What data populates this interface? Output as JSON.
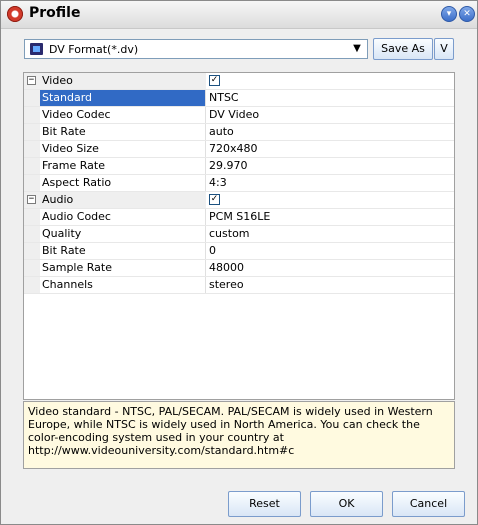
{
  "window": {
    "title": "Profile"
  },
  "format": {
    "value": "DV Format(*.dv)",
    "save_as_label": "Save As",
    "v_label": "V"
  },
  "grid": {
    "video": {
      "label": "Video",
      "checked": "✓",
      "items": [
        {
          "name": "Standard",
          "value": "NTSC"
        },
        {
          "name": "Video Codec",
          "value": "DV Video"
        },
        {
          "name": "Bit Rate",
          "value": "auto"
        },
        {
          "name": "Video Size",
          "value": "720x480"
        },
        {
          "name": "Frame Rate",
          "value": "29.970"
        },
        {
          "name": "Aspect Ratio",
          "value": "4:3"
        }
      ]
    },
    "audio": {
      "label": "Audio",
      "checked": "✓",
      "items": [
        {
          "name": "Audio Codec",
          "value": "PCM S16LE"
        },
        {
          "name": "Quality",
          "value": "custom"
        },
        {
          "name": "Bit Rate",
          "value": "0"
        },
        {
          "name": "Sample Rate",
          "value": "48000"
        },
        {
          "name": "Channels",
          "value": "stereo"
        }
      ]
    },
    "expander_symbol": "−"
  },
  "description": "Video standard - NTSC, PAL/SECAM. PAL/SECAM is widely used in Western Europe, while NTSC is widely used in North America. You can check the color-encoding system used in your country at http://www.videouniversity.com/standard.htm#c",
  "buttons": {
    "reset": "Reset",
    "ok": "OK",
    "cancel": "Cancel"
  },
  "colors": {
    "selection": "#316ac5",
    "description_bg": "#fffae0",
    "button_border": "#7b9ccc"
  }
}
